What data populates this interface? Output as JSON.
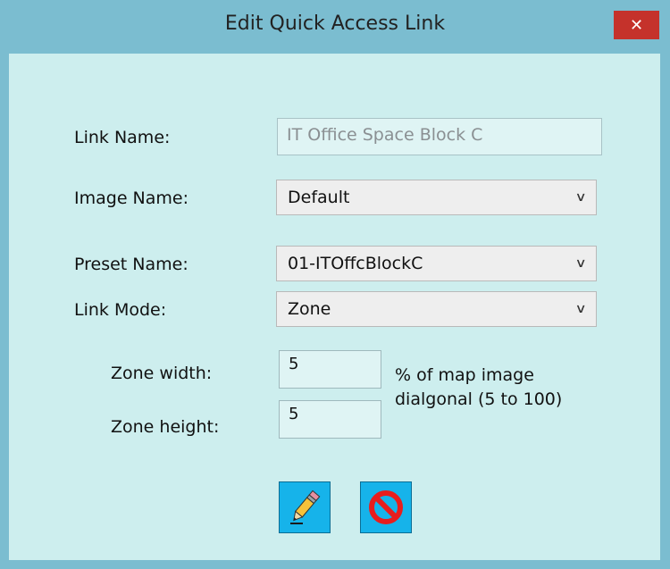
{
  "window": {
    "title": "Edit Quick Access Link",
    "close_symbol": "✕"
  },
  "form": {
    "link_name": {
      "label": "Link Name:",
      "value": "IT Office Space Block C"
    },
    "image_name": {
      "label": "Image Name:",
      "value": "Default"
    },
    "preset_name": {
      "label": "Preset Name:",
      "value": "01-ITOffcBlockC"
    },
    "link_mode": {
      "label": "Link Mode:",
      "value": "Zone"
    },
    "zone_width": {
      "label": "Zone width:",
      "value": "5"
    },
    "zone_height": {
      "label": "Zone height:",
      "value": "5"
    },
    "zone_hint_line1": "%  of map image",
    "zone_hint_line2": "dialgonal (5 to 100)"
  },
  "buttons": {
    "edit": {
      "icon": "pencil-icon"
    },
    "cancel": {
      "icon": "prohibited-icon"
    }
  },
  "colors": {
    "title_bar": "#7bbdd0",
    "client_bg": "#cdeeee",
    "close_button": "#c5322b",
    "icon_button": "#16b3ea"
  }
}
